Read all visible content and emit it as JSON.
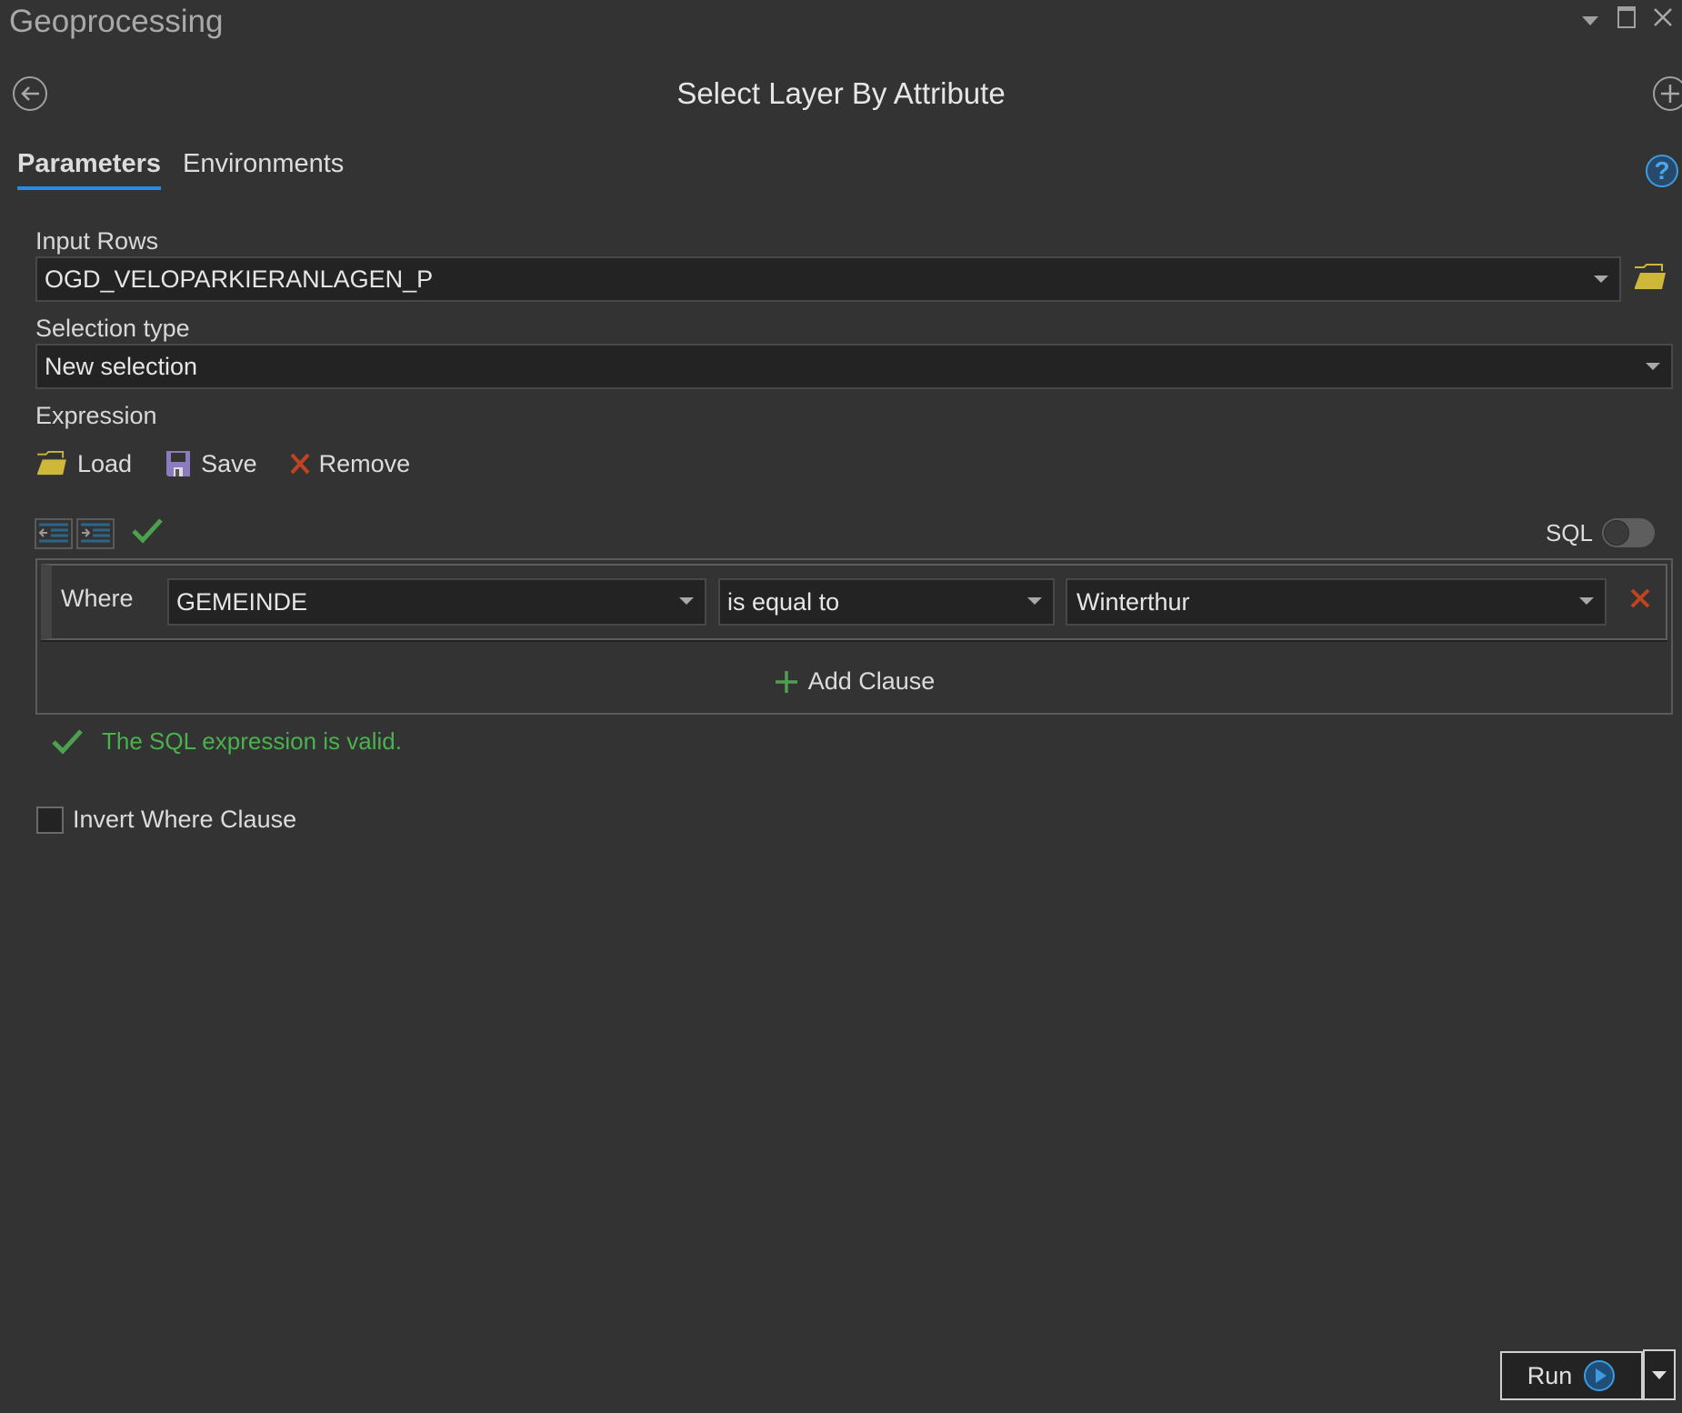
{
  "pane": {
    "title": "Geoprocessing",
    "controls": [
      "options-dropdown",
      "maximize",
      "close"
    ]
  },
  "tool": {
    "title": "Select Layer By Attribute",
    "back_icon": "back-arrow-circle-icon",
    "add_icon": "add-circle-icon"
  },
  "tabs": [
    {
      "label": "Parameters",
      "active": true
    },
    {
      "label": "Environments",
      "active": false
    }
  ],
  "help_icon": "help-question-icon",
  "params": {
    "input_rows": {
      "label": "Input Rows",
      "value": "OGD_VELOPARKIERANLAGEN_P"
    },
    "selection_type": {
      "label": "Selection type",
      "value": "New selection"
    },
    "expression": {
      "label": "Expression",
      "toolbar": {
        "load": "Load",
        "save": "Save",
        "remove": "Remove"
      },
      "sql_toggle": {
        "label": "SQL",
        "on": false
      },
      "clauses": [
        {
          "where_label": "Where",
          "field": "GEMEINDE",
          "operator": "is equal to",
          "value": "Winterthur"
        }
      ],
      "add_clause": "Add Clause",
      "validation": "The SQL expression is valid."
    },
    "invert": {
      "label": "Invert Where Clause",
      "checked": false
    }
  },
  "run": {
    "label": "Run"
  },
  "colors": {
    "accent": "#2b8ae2",
    "valid_green": "#4cb050",
    "remove_red": "#c0441f",
    "folder_yellow": "#cdb83a",
    "save_purple": "#8d7bbf"
  }
}
